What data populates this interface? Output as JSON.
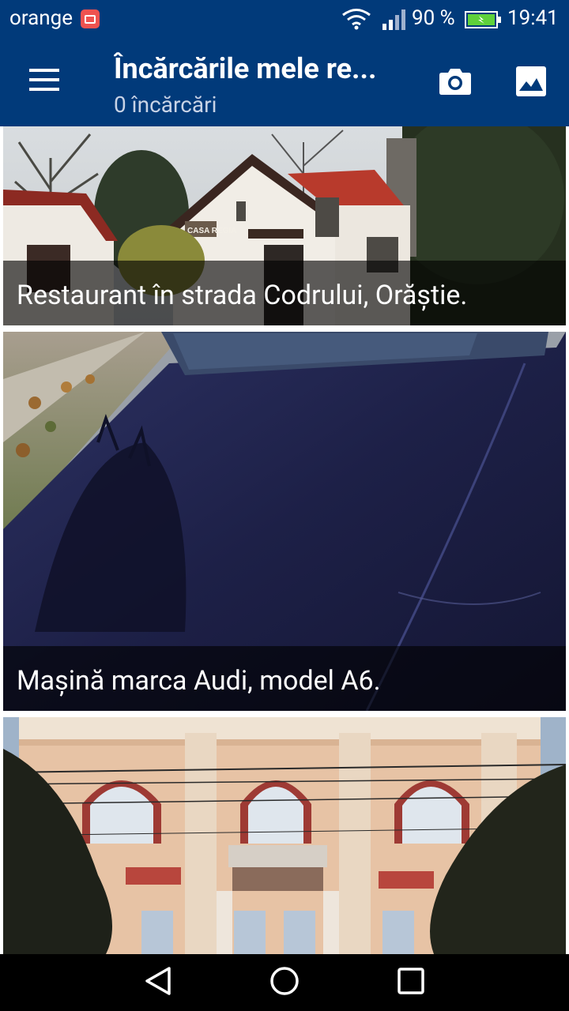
{
  "status_bar": {
    "carrier": "orange",
    "battery_percent": "90 %",
    "time": "19:41",
    "icons": [
      "notification-icon",
      "wifi-icon",
      "signal-icon",
      "battery-charging-icon"
    ]
  },
  "app_bar": {
    "title": "Încărcările mele re...",
    "subtitle": "0 încărcări",
    "icons": [
      "menu-icon",
      "camera-icon",
      "gallery-icon"
    ]
  },
  "feed": {
    "items": [
      {
        "caption": "Restaurant în strada Codrului, Orăștie.",
        "sign_text": "CASA REGIA"
      },
      {
        "caption": "Mașină marca Audi, model A6."
      },
      {
        "caption": ""
      }
    ]
  },
  "nav_bar": {
    "icons": [
      "back-icon",
      "home-icon",
      "recents-icon"
    ]
  },
  "colors": {
    "primary": "#013a7a",
    "caption_overlay": "#000000",
    "nav_bar": "#000000"
  }
}
